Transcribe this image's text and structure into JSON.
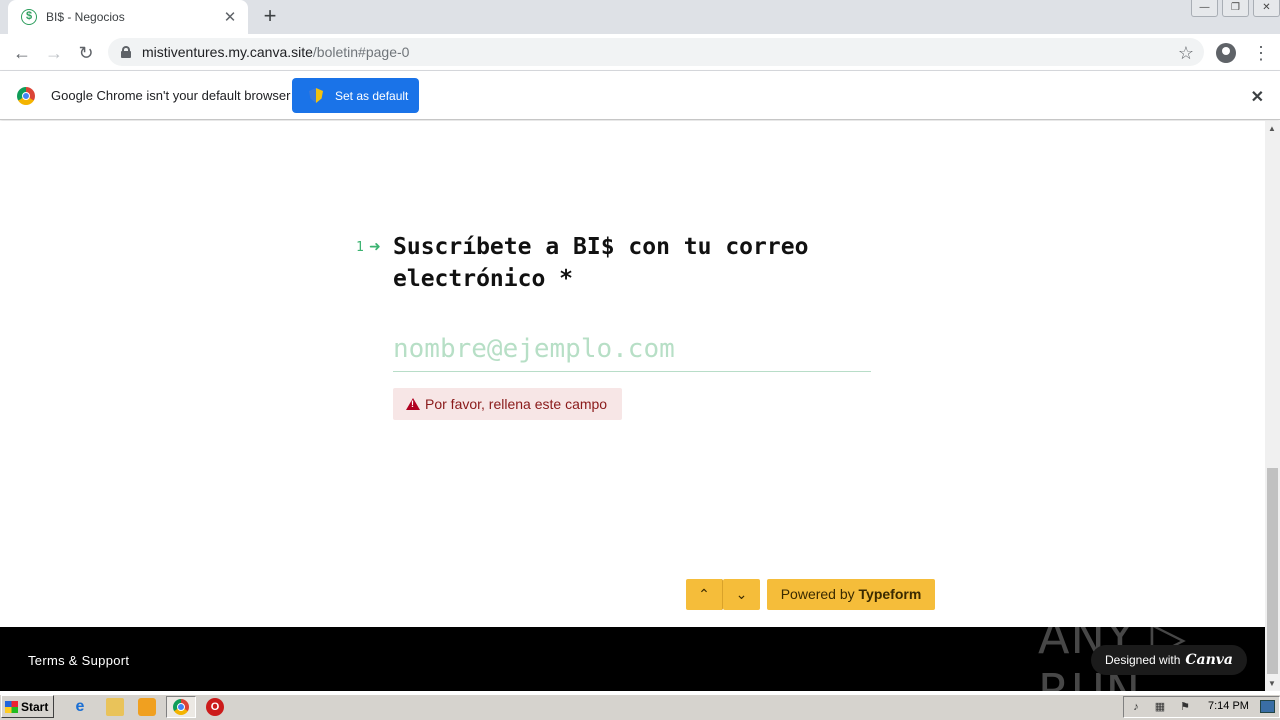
{
  "browser": {
    "tab": {
      "title": "BI$ - Negocios",
      "favicon_icon": "dollar-icon",
      "close_glyph": "✕"
    },
    "new_tab_glyph": "+",
    "url": {
      "host": "mistiventures.my.canva.site",
      "path": "/boletin#page-0"
    }
  },
  "infobar": {
    "message": "Google Chrome isn't your default browser",
    "button_label": "Set as default",
    "close_glyph": "✕"
  },
  "form": {
    "question_number": "1",
    "question_text": "Suscríbete a BI$ con tu correo electrónico *",
    "email_value": "",
    "email_placeholder": "nombre@ejemplo.com",
    "error_message": "Por favor, rellena este campo",
    "nav_up_glyph": "⌃",
    "nav_down_glyph": "⌄",
    "powered_prefix": "Powered by",
    "powered_brand": "Typeform",
    "accent_color": "#3cb371",
    "button_color": "#f5bd3a"
  },
  "footer": {
    "terms_label": "Terms & Support",
    "designed_with": "Designed with",
    "brand": "Canva"
  },
  "watermark": "ANY ▷ RUN",
  "taskbar": {
    "start_label": "Start",
    "clock": "7:14 PM"
  }
}
